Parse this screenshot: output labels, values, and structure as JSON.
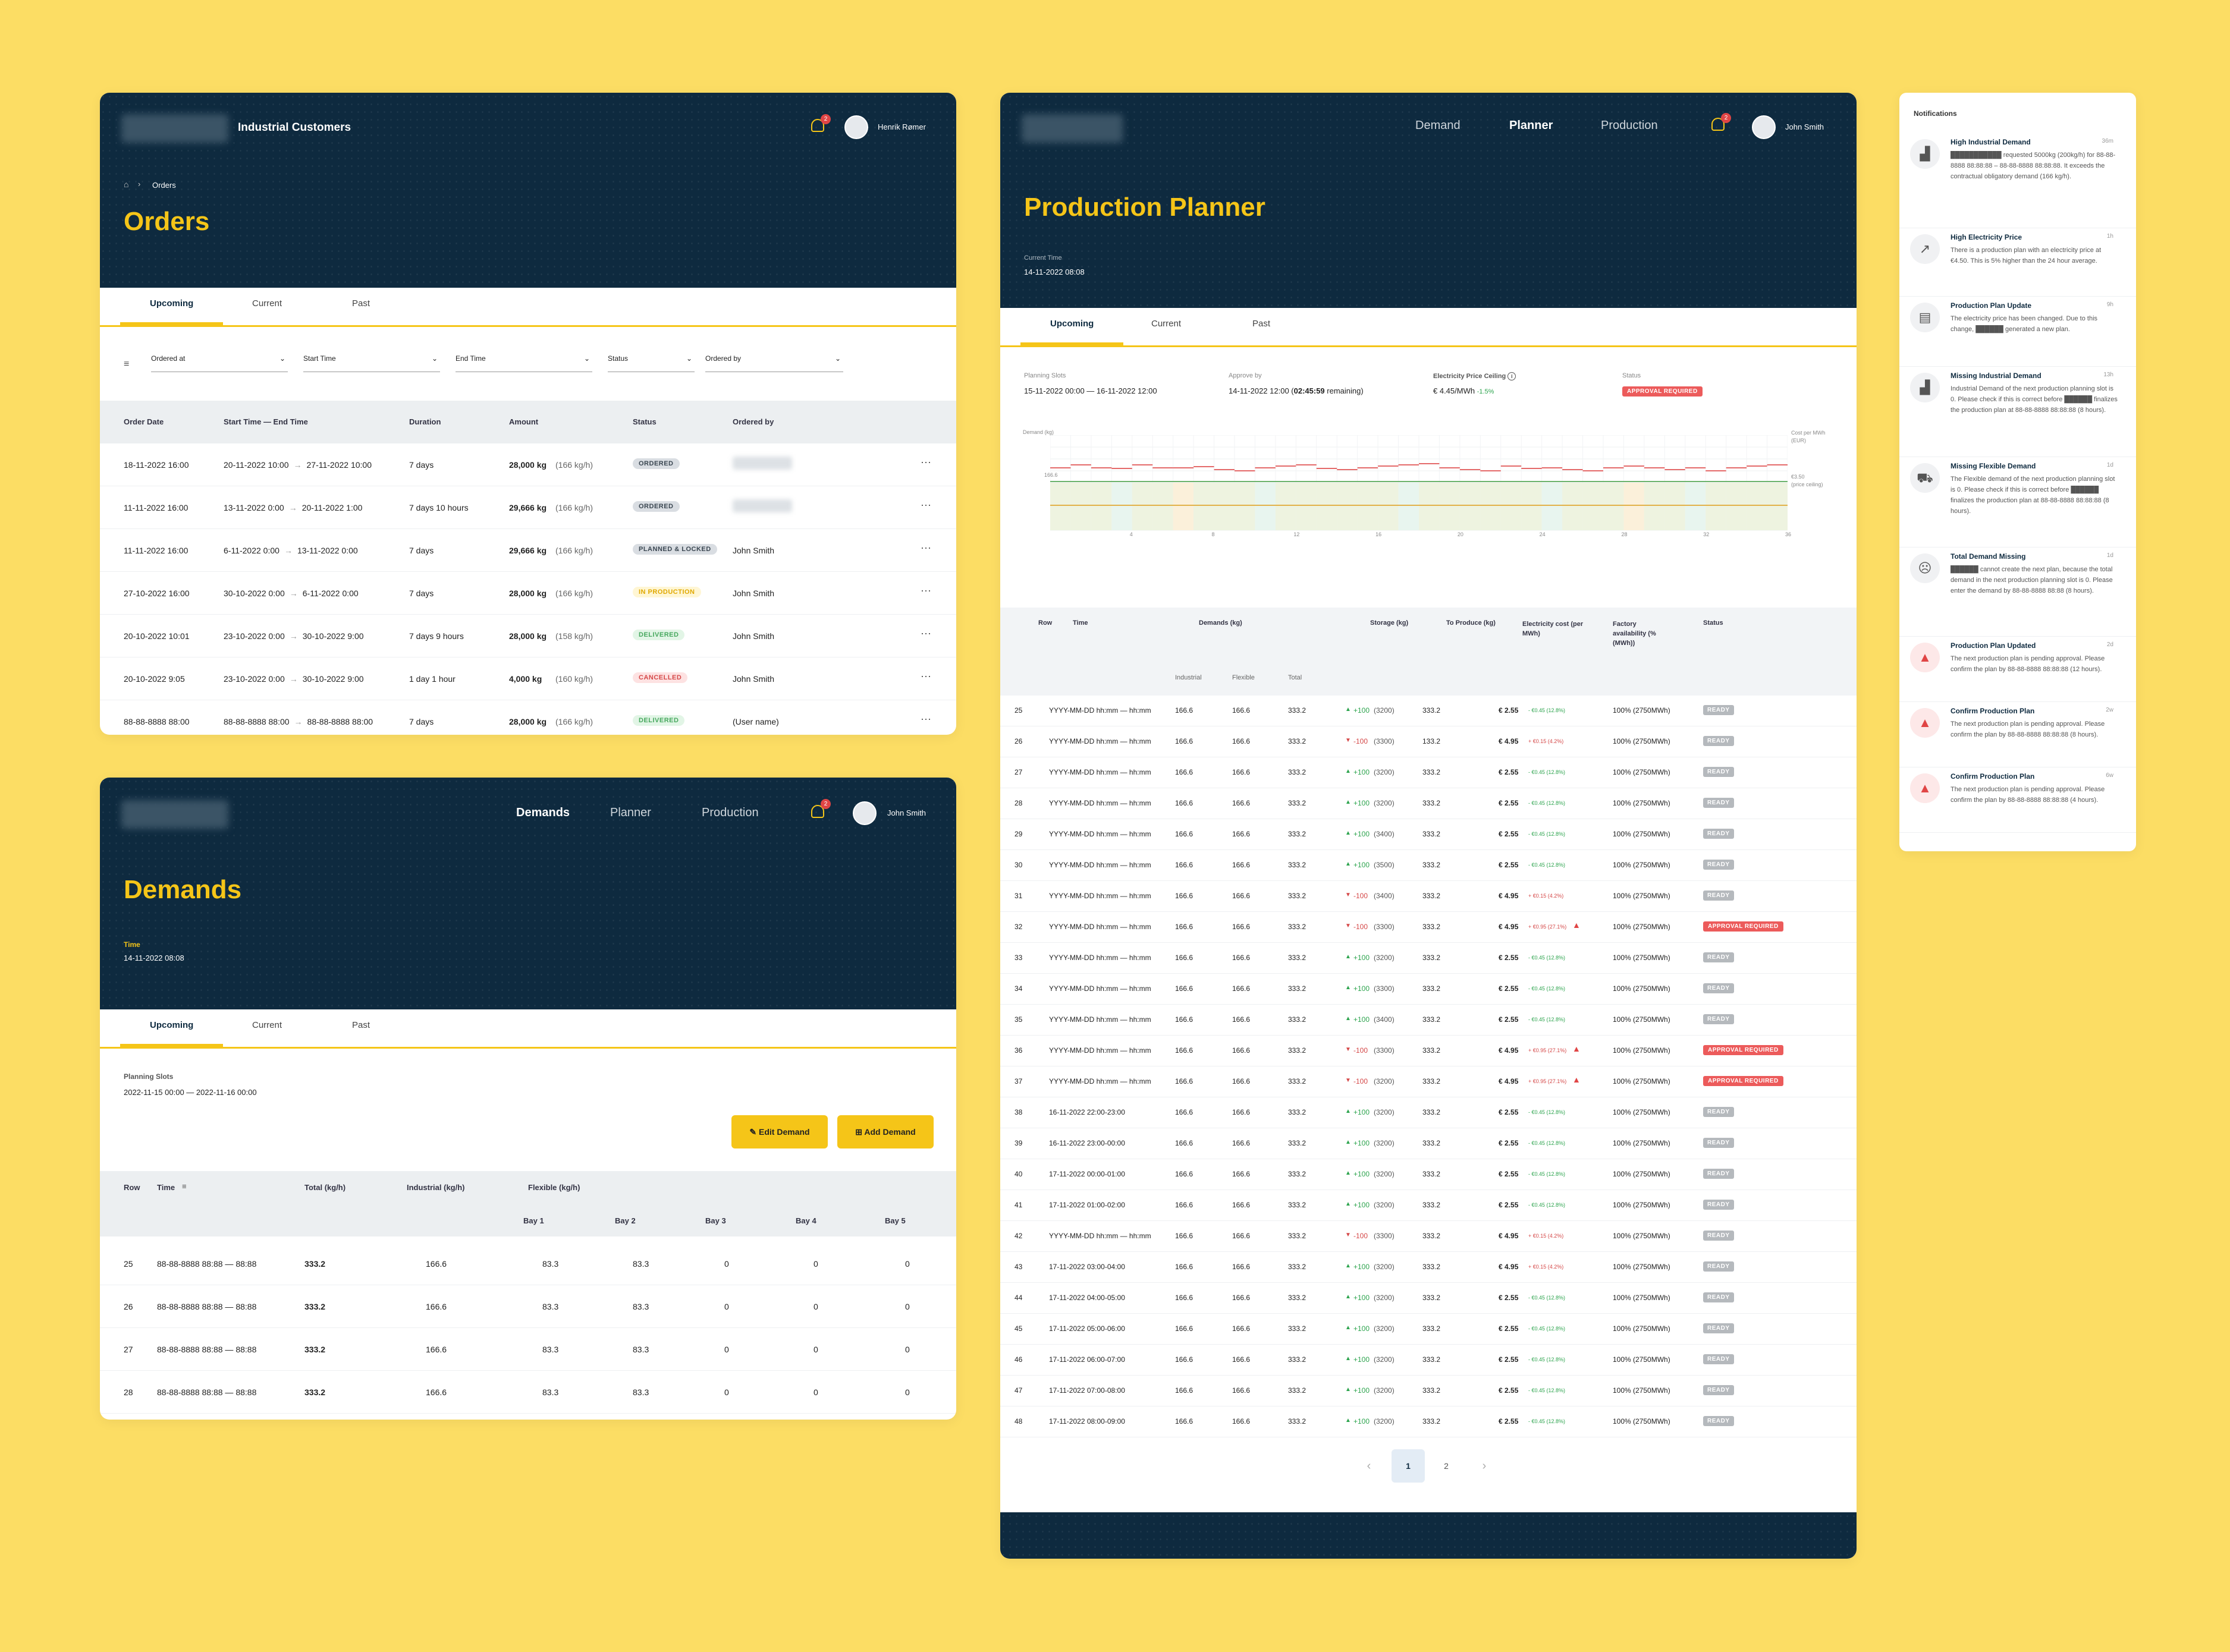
{
  "orders": {
    "title_app": "Industrial Customers",
    "user": "Henrik Rømer",
    "bell_count": "2",
    "breadcrumb": "Orders",
    "title": "Orders",
    "tabs": [
      "Upcoming",
      "Current",
      "Past"
    ],
    "filters": [
      "Ordered at",
      "Start Time",
      "End Time",
      "Status",
      "Ordered by"
    ],
    "headers": [
      "Order Date",
      "Start Time — End Time",
      "Duration",
      "Amount",
      "Status",
      "Ordered by"
    ],
    "rows": [
      {
        "date": "18-11-2022 16:00",
        "start": "20-11-2022 10:00",
        "end": "27-11-2022 10:00",
        "duration": "7 days",
        "amount": "28,000 kg",
        "rate": "(166 kg/h)",
        "status": "ORDERED",
        "sclass": "b-ordered",
        "by": ""
      },
      {
        "date": "11-11-2022 16:00",
        "start": "13-11-2022 0:00",
        "end": "20-11-2022 1:00",
        "duration": "7 days 10 hours",
        "amount": "29,666 kg",
        "rate": "(166 kg/h)",
        "status": "ORDERED",
        "sclass": "b-ordered",
        "by": ""
      },
      {
        "date": "11-11-2022 16:00",
        "start": "6-11-2022 0:00",
        "end": "13-11-2022 0:00",
        "duration": "7 days",
        "amount": "29,666 kg",
        "rate": "(166 kg/h)",
        "status": "PLANNED & LOCKED",
        "sclass": "b-planned",
        "by": "John Smith"
      },
      {
        "date": "27-10-2022 16:00",
        "start": "30-10-2022 0:00",
        "end": "6-11-2022 0:00",
        "duration": "7 days",
        "amount": "28,000 kg",
        "rate": "(166 kg/h)",
        "status": "IN PRODUCTION",
        "sclass": "b-inprod",
        "by": "John Smith"
      },
      {
        "date": "20-10-2022 10:01",
        "start": "23-10-2022 0:00",
        "end": "30-10-2022 9:00",
        "duration": "7 days 9 hours",
        "amount": "28,000 kg",
        "rate": "(158 kg/h)",
        "status": "DELIVERED",
        "sclass": "b-delivered",
        "by": "John Smith"
      },
      {
        "date": "20-10-2022 9:05",
        "start": "23-10-2022 0:00",
        "end": "30-10-2022 9:00",
        "duration": "1 day 1 hour",
        "amount": "4,000 kg",
        "rate": "(160 kg/h)",
        "status": "CANCELLED",
        "sclass": "b-cancelled",
        "by": "John Smith"
      },
      {
        "date": "88-88-8888 88:00",
        "start": "88-88-8888 88:00",
        "end": "88-88-8888 88:00",
        "duration": "7 days",
        "amount": "28,000 kg",
        "rate": "(166 kg/h)",
        "status": "DELIVERED",
        "sclass": "b-delivered",
        "by": "(User name)"
      }
    ]
  },
  "demands": {
    "nav": [
      "Demands",
      "Planner",
      "Production"
    ],
    "user": "John Smith",
    "bell_count": "2",
    "title": "Demands",
    "time_label": "Time",
    "time_value": "14-11-2022 08:08",
    "tabs": [
      "Upcoming",
      "Current",
      "Past"
    ],
    "slots_label": "Planning Slots",
    "slots_value": "2022-11-15 00:00 — 2022-11-16 00:00",
    "edit_btn": "Edit Demand",
    "add_btn": "Add Demand",
    "headers": [
      "Row",
      "Time",
      "Total (kg/h)",
      "Industrial (kg/h)",
      "Flexible (kg/h)"
    ],
    "bays": [
      "Bay 1",
      "Bay 2",
      "Bay 3",
      "Bay 4",
      "Bay 5"
    ],
    "rows": [
      {
        "row": "25",
        "time": "88-88-8888 88:88 — 88:88",
        "total": "333.2",
        "ind": "166.6",
        "b1": "83.3",
        "b2": "83.3",
        "b3": "0",
        "b4": "0",
        "b5": "0"
      },
      {
        "row": "26",
        "time": "88-88-8888 88:88 — 88:88",
        "total": "333.2",
        "ind": "166.6",
        "b1": "83.3",
        "b2": "83.3",
        "b3": "0",
        "b4": "0",
        "b5": "0"
      },
      {
        "row": "27",
        "time": "88-88-8888 88:88 — 88:88",
        "total": "333.2",
        "ind": "166.6",
        "b1": "83.3",
        "b2": "83.3",
        "b3": "0",
        "b4": "0",
        "b5": "0"
      },
      {
        "row": "28",
        "time": "88-88-8888 88:88 — 88:88",
        "total": "333.2",
        "ind": "166.6",
        "b1": "83.3",
        "b2": "83.3",
        "b3": "0",
        "b4": "0",
        "b5": "0"
      }
    ]
  },
  "planner": {
    "nav": [
      "Demand",
      "Planner",
      "Production"
    ],
    "user": "John Smith",
    "bell_count": "2",
    "title": "Production Planner",
    "time_label": "Current Time",
    "time_value": "14-11-2022 08:08",
    "tabs": [
      "Upcoming",
      "Current",
      "Past"
    ],
    "info": {
      "slots_label": "Planning Slots",
      "slots_value": "15-11-2022 00:00 — 16-11-2022 12:00",
      "approve_label": "Approve by",
      "approve_value": "14-11-2022 12:00 (",
      "approve_bold": "02:45:59",
      "approve_tail": " remaining)",
      "price_label": "Electricity Price Ceiling",
      "price_value": "€ 4.45/MWh",
      "price_delta": "-1.5%",
      "status_label": "Status",
      "status_value": "APPROVAL REQUIRED"
    },
    "chart": {
      "ylabel": "Demand (kg)",
      "ytick": "166.6",
      "right_label_1": "Cost per MWh",
      "right_label_2": "(EUR)",
      "right_tick": "€3.50",
      "right_tick_2": "(price ceiling)",
      "xticks": [
        "4",
        "8",
        "12",
        "16",
        "20",
        "24",
        "28",
        "32",
        "36"
      ]
    },
    "headers": {
      "row": "Row",
      "time": "Time",
      "demands": "Demands (kg)",
      "storage": "Storage (kg)",
      "produce": "To Produce (kg)",
      "cost": "Electricity cost (per MWh)",
      "factory": "Factory availability (% (MWh))",
      "status": "Status",
      "industrial": "Industrial",
      "flexible": "Flexible",
      "total": "Total"
    },
    "rows": [
      {
        "row": "25",
        "time": "YYYY-MM-DD hh:mm — hh:mm",
        "i": "166.6",
        "f": "166.6",
        "t": "333.2",
        "dir": "up",
        "st": "+100",
        "stp": "(3200)",
        "prod": "333.2",
        "cost": "€ 2.55",
        "cd": "- €0.45 (12.8%)",
        "warn": "",
        "fa": "100% (2750MWh)",
        "status": "READY"
      },
      {
        "row": "26",
        "time": "YYYY-MM-DD hh:mm — hh:mm",
        "i": "166.6",
        "f": "166.6",
        "t": "333.2",
        "dir": "down",
        "st": "-100",
        "stp": "(3300)",
        "prod": "133.2",
        "cost": "€ 4.95",
        "cd": "+ €0.15 (4.2%)",
        "warn": "",
        "fa": "100% (2750MWh)",
        "status": "READY"
      },
      {
        "row": "27",
        "time": "YYYY-MM-DD hh:mm — hh:mm",
        "i": "166.6",
        "f": "166.6",
        "t": "333.2",
        "dir": "up",
        "st": "+100",
        "stp": "(3200)",
        "prod": "333.2",
        "cost": "€ 2.55",
        "cd": "- €0.45 (12.8%)",
        "warn": "",
        "fa": "100% (2750MWh)",
        "status": "READY"
      },
      {
        "row": "28",
        "time": "YYYY-MM-DD hh:mm — hh:mm",
        "i": "166.6",
        "f": "166.6",
        "t": "333.2",
        "dir": "up",
        "st": "+100",
        "stp": "(3200)",
        "prod": "333.2",
        "cost": "€ 2.55",
        "cd": "- €0.45 (12.8%)",
        "warn": "",
        "fa": "100% (2750MWh)",
        "status": "READY"
      },
      {
        "row": "29",
        "time": "YYYY-MM-DD hh:mm — hh:mm",
        "i": "166.6",
        "f": "166.6",
        "t": "333.2",
        "dir": "up",
        "st": "+100",
        "stp": "(3400)",
        "prod": "333.2",
        "cost": "€ 2.55",
        "cd": "- €0.45 (12.8%)",
        "warn": "",
        "fa": "100% (2750MWh)",
        "status": "READY"
      },
      {
        "row": "30",
        "time": "YYYY-MM-DD hh:mm — hh:mm",
        "i": "166.6",
        "f": "166.6",
        "t": "333.2",
        "dir": "up",
        "st": "+100",
        "stp": "(3500)",
        "prod": "333.2",
        "cost": "€ 2.55",
        "cd": "- €0.45 (12.8%)",
        "warn": "",
        "fa": "100% (2750MWh)",
        "status": "READY"
      },
      {
        "row": "31",
        "time": "YYYY-MM-DD hh:mm — hh:mm",
        "i": "166.6",
        "f": "166.6",
        "t": "333.2",
        "dir": "down",
        "st": "-100",
        "stp": "(3400)",
        "prod": "333.2",
        "cost": "€ 4.95",
        "cd": "+ €0.15 (4.2%)",
        "warn": "",
        "fa": "100% (2750MWh)",
        "status": "READY"
      },
      {
        "row": "32",
        "time": "YYYY-MM-DD hh:mm — hh:mm",
        "i": "166.6",
        "f": "166.6",
        "t": "333.2",
        "dir": "down",
        "st": "-100",
        "stp": "(3300)",
        "prod": "333.2",
        "cost": "€ 4.95",
        "cd": "+ €0.95 (27.1%)",
        "warn": "!",
        "fa": "100% (2750MWh)",
        "status": "APPROVAL REQUIRED"
      },
      {
        "row": "33",
        "time": "YYYY-MM-DD hh:mm — hh:mm",
        "i": "166.6",
        "f": "166.6",
        "t": "333.2",
        "dir": "up",
        "st": "+100",
        "stp": "(3200)",
        "prod": "333.2",
        "cost": "€ 2.55",
        "cd": "- €0.45 (12.8%)",
        "warn": "",
        "fa": "100% (2750MWh)",
        "status": "READY"
      },
      {
        "row": "34",
        "time": "YYYY-MM-DD hh:mm — hh:mm",
        "i": "166.6",
        "f": "166.6",
        "t": "333.2",
        "dir": "up",
        "st": "+100",
        "stp": "(3300)",
        "prod": "333.2",
        "cost": "€ 2.55",
        "cd": "- €0.45 (12.8%)",
        "warn": "",
        "fa": "100% (2750MWh)",
        "status": "READY"
      },
      {
        "row": "35",
        "time": "YYYY-MM-DD hh:mm — hh:mm",
        "i": "166.6",
        "f": "166.6",
        "t": "333.2",
        "dir": "up",
        "st": "+100",
        "stp": "(3400)",
        "prod": "333.2",
        "cost": "€ 2.55",
        "cd": "- €0.45 (12.8%)",
        "warn": "",
        "fa": "100% (2750MWh)",
        "status": "READY"
      },
      {
        "row": "36",
        "time": "YYYY-MM-DD hh:mm — hh:mm",
        "i": "166.6",
        "f": "166.6",
        "t": "333.2",
        "dir": "down",
        "st": "-100",
        "stp": "(3300)",
        "prod": "333.2",
        "cost": "€ 4.95",
        "cd": "+ €0.95 (27.1%)",
        "warn": "!",
        "fa": "100% (2750MWh)",
        "status": "APPROVAL REQUIRED"
      },
      {
        "row": "37",
        "time": "YYYY-MM-DD hh:mm — hh:mm",
        "i": "166.6",
        "f": "166.6",
        "t": "333.2",
        "dir": "down",
        "st": "-100",
        "stp": "(3200)",
        "prod": "333.2",
        "cost": "€ 4.95",
        "cd": "+ €0.95 (27.1%)",
        "warn": "!",
        "fa": "100% (2750MWh)",
        "status": "APPROVAL REQUIRED"
      },
      {
        "row": "38",
        "time": "16-11-2022 22:00-23:00",
        "i": "166.6",
        "f": "166.6",
        "t": "333.2",
        "dir": "up",
        "st": "+100",
        "stp": "(3200)",
        "prod": "333.2",
        "cost": "€ 2.55",
        "cd": "- €0.45 (12.8%)",
        "warn": "",
        "fa": "100% (2750MWh)",
        "status": "READY"
      },
      {
        "row": "39",
        "time": "16-11-2022 23:00-00:00",
        "i": "166.6",
        "f": "166.6",
        "t": "333.2",
        "dir": "up",
        "st": "+100",
        "stp": "(3200)",
        "prod": "333.2",
        "cost": "€ 2.55",
        "cd": "- €0.45 (12.8%)",
        "warn": "",
        "fa": "100% (2750MWh)",
        "status": "READY"
      },
      {
        "row": "40",
        "time": "17-11-2022 00:00-01:00",
        "i": "166.6",
        "f": "166.6",
        "t": "333.2",
        "dir": "up",
        "st": "+100",
        "stp": "(3200)",
        "prod": "333.2",
        "cost": "€ 2.55",
        "cd": "- €0.45 (12.8%)",
        "warn": "",
        "fa": "100% (2750MWh)",
        "status": "READY"
      },
      {
        "row": "41",
        "time": "17-11-2022 01:00-02:00",
        "i": "166.6",
        "f": "166.6",
        "t": "333.2",
        "dir": "up",
        "st": "+100",
        "stp": "(3200)",
        "prod": "333.2",
        "cost": "€ 2.55",
        "cd": "- €0.45 (12.8%)",
        "warn": "",
        "fa": "100% (2750MWh)",
        "status": "READY"
      },
      {
        "row": "42",
        "time": "YYYY-MM-DD hh:mm — hh:mm",
        "i": "166.6",
        "f": "166.6",
        "t": "333.2",
        "dir": "down",
        "st": "-100",
        "stp": "(3300)",
        "prod": "333.2",
        "cost": "€ 4.95",
        "cd": "+ €0.15 (4.2%)",
        "warn": "",
        "fa": "100% (2750MWh)",
        "status": "READY"
      },
      {
        "row": "43",
        "time": "17-11-2022 03:00-04:00",
        "i": "166.6",
        "f": "166.6",
        "t": "333.2",
        "dir": "up",
        "st": "+100",
        "stp": "(3200)",
        "prod": "333.2",
        "cost": "€ 4.95",
        "cd": "+ €0.15 (4.2%)",
        "warn": "",
        "fa": "100% (2750MWh)",
        "status": "READY"
      },
      {
        "row": "44",
        "time": "17-11-2022 04:00-05:00",
        "i": "166.6",
        "f": "166.6",
        "t": "333.2",
        "dir": "up",
        "st": "+100",
        "stp": "(3200)",
        "prod": "333.2",
        "cost": "€ 2.55",
        "cd": "- €0.45 (12.8%)",
        "warn": "",
        "fa": "100% (2750MWh)",
        "status": "READY"
      },
      {
        "row": "45",
        "time": "17-11-2022 05:00-06:00",
        "i": "166.6",
        "f": "166.6",
        "t": "333.2",
        "dir": "up",
        "st": "+100",
        "stp": "(3200)",
        "prod": "333.2",
        "cost": "€ 2.55",
        "cd": "- €0.45 (12.8%)",
        "warn": "",
        "fa": "100% (2750MWh)",
        "status": "READY"
      },
      {
        "row": "46",
        "time": "17-11-2022 06:00-07:00",
        "i": "166.6",
        "f": "166.6",
        "t": "333.2",
        "dir": "up",
        "st": "+100",
        "stp": "(3200)",
        "prod": "333.2",
        "cost": "€ 2.55",
        "cd": "- €0.45 (12.8%)",
        "warn": "",
        "fa": "100% (2750MWh)",
        "status": "READY"
      },
      {
        "row": "47",
        "time": "17-11-2022 07:00-08:00",
        "i": "166.6",
        "f": "166.6",
        "t": "333.2",
        "dir": "up",
        "st": "+100",
        "stp": "(3200)",
        "prod": "333.2",
        "cost": "€ 2.55",
        "cd": "- €0.45 (12.8%)",
        "warn": "",
        "fa": "100% (2750MWh)",
        "status": "READY"
      },
      {
        "row": "48",
        "time": "17-11-2022 08:00-09:00",
        "i": "166.6",
        "f": "166.6",
        "t": "333.2",
        "dir": "up",
        "st": "+100",
        "stp": "(3200)",
        "prod": "333.2",
        "cost": "€ 2.55",
        "cd": "- €0.45 (12.8%)",
        "warn": "",
        "fa": "100% (2750MWh)",
        "status": "READY"
      }
    ],
    "pagination": {
      "current": "1",
      "next": "2"
    }
  },
  "notifications": {
    "title": "Notifications",
    "items": [
      {
        "icon": "factory-icon",
        "glyph": "▟",
        "title": "High Industrial Demand",
        "time": "36m",
        "body": "███████████ requested 5000kg (200kg/h) for 88-88-8888 88:88:88 – 88-88-8888 88:88:88. It exceeds the contractual obligatory demand (166 kg/h)."
      },
      {
        "icon": "trend-up-icon",
        "glyph": "↗",
        "title": "High Electricity Price",
        "time": "1h",
        "body": "There is a production plan with an electricity price at €4.50. This is 5% higher than the 24 hour average."
      },
      {
        "icon": "document-icon",
        "glyph": "▤",
        "title": "Production Plan Update",
        "time": "9h",
        "body": "The electricity price has been changed. Due to this change, ██████ generated a new plan."
      },
      {
        "icon": "factory-icon",
        "glyph": "▟",
        "title": "Missing Industrial Demand",
        "time": "13h",
        "body": "Industrial Demand of the next production planning slot is 0. Please check if this is correct before ██████ finalizes the production plan at 88-88-8888 88:88:88 (8 hours)."
      },
      {
        "icon": "truck-icon",
        "glyph": "⛟",
        "title": "Missing Flexible Demand",
        "time": "1d",
        "body": "The Flexible demand of the next production planning slot is 0. Please check if this is correct before ██████ finalizes the production plan at 88-88-8888 88:88:88 (8 hours)."
      },
      {
        "icon": "sad-face-icon",
        "glyph": "☹",
        "title": "Total Demand Missing",
        "time": "1d",
        "body": "██████ cannot create the next plan, because the total demand in the next production planning slot is 0. Please enter the demand by 88-88-8888 88:88 (8 hours)."
      },
      {
        "icon": "warning-icon",
        "glyph": "▲",
        "title": "Production Plan Updated",
        "time": "2d",
        "body": "The next production plan is pending approval. Please confirm the plan by 88-88-8888 88:88:88 (12 hours)."
      },
      {
        "icon": "warning-icon",
        "glyph": "▲",
        "title": "Confirm Production Plan",
        "time": "2w",
        "body": "The next production plan is pending approval. Please confirm the plan by 88-88-8888 88:88:88 (8 hours)."
      },
      {
        "icon": "warning-icon",
        "glyph": "▲",
        "title": "Confirm Production Plan",
        "time": "6w",
        "body": "The next production plan is pending approval. Please confirm the plan by 88-88-8888 88:88:88 (4 hours)."
      }
    ]
  }
}
